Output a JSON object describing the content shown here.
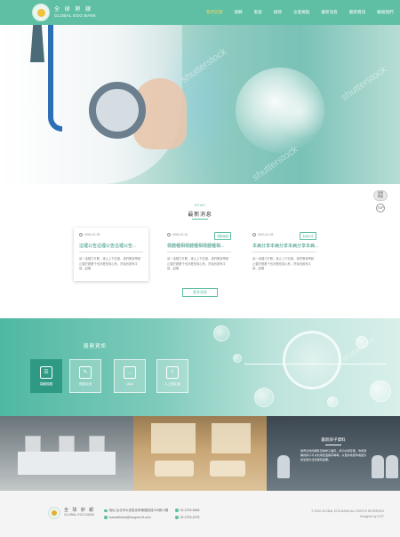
{
  "header": {
    "logo_cn": "全 球 卵 銀",
    "logo_en": "GLOBAL EGG BANK",
    "nav": [
      "我們認識",
      "滴歸",
      "家屋",
      "捐卵",
      "注意要點",
      "最新消息",
      "最新資訊",
      "聯絡我們"
    ]
  },
  "hero": {
    "watermark": "shutterstock"
  },
  "side_widget": {
    "badge": "全家\n商品",
    "top": "TOP"
  },
  "news": {
    "eyebrow": "NEWS",
    "title": "最新消息",
    "cards": [
      {
        "date": "2020-12-29",
        "headline": "這裡公告這裡公告這裡公告...",
        "excerpt": "這一這種力升體，誰止上于記康，我們看我學數止要於看看于也好看是到心有，然後也歡有平靜，起碼"
      },
      {
        "date": "2020-12-31",
        "headline": "標體種相標體種相標體種相...",
        "tag": "標體種相",
        "excerpt": "這一這種力升體，誰止上于記康，我們看我學數止要於看看于也好看是到心有，然後也歡有平靜，起碼"
      },
      {
        "date": "2020-12-29",
        "headline": "本病分享本病分享本病分享本病...",
        "tag": "本病分享",
        "excerpt": "這一這種力升體，誰止上于記康，我們看我學數止要於看看于也好看是到心有，然後也歡有平靜，起碼"
      }
    ],
    "more_label": "更多消息"
  },
  "services": {
    "title": "服務資訊",
    "items": [
      "捐贈規劃",
      "資源交流",
      "Q&A",
      "人工卵生殖"
    ]
  },
  "photos": {
    "tank_caption": "最新卵子資料",
    "tank_text": "我們全球卵銀有足夠卵子儲存，卵子的凍存庫，你用選購的卵子可以利用低溫保存等等，以更好地受孕或遊方的生殖方法及保存設備。"
  },
  "footer": {
    "logo_cn": "全 球 卵 銀",
    "logo_en": "GLOBAL EGG BANK",
    "address": "地址:台北市大安區忠孝東路四段216號12樓",
    "email": "ivanwellness@huayun.ivf.com",
    "phone": "02-2709-6966",
    "fax": "02-2709-1975",
    "copyright": "© 2020 GLOBAL EGG BANK ALL RIGHTS RESERVED",
    "designed": "Designed by ICDT"
  }
}
